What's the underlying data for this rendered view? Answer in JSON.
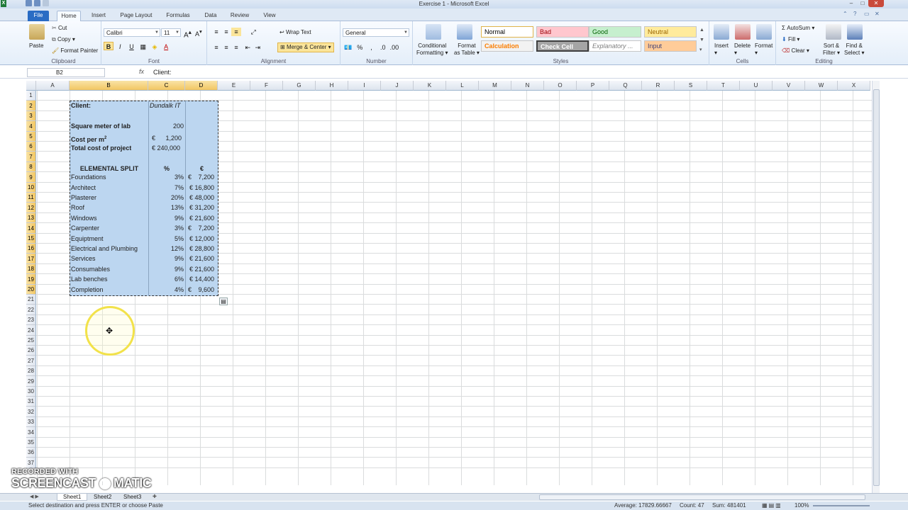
{
  "window": {
    "title": "Exercise 1 - Microsoft Excel"
  },
  "ribbon_tabs": [
    "File",
    "Home",
    "Insert",
    "Page Layout",
    "Formulas",
    "Data",
    "Review",
    "View"
  ],
  "clipboard": {
    "paste": "Paste",
    "cut": "Cut",
    "copy": "Copy",
    "format_painter": "Format Painter",
    "label": "Clipboard"
  },
  "font": {
    "family": "Calibri",
    "size": "11",
    "label": "Font",
    "bold": "B",
    "italic": "I",
    "underline": "U"
  },
  "alignment": {
    "wrap_text": "Wrap Text",
    "merge_center": "Merge & Center",
    "label": "Alignment"
  },
  "number": {
    "format": "General",
    "percent": "%",
    "comma": ",",
    "label": "Number"
  },
  "styles": {
    "conditional": "Conditional",
    "formatting": "Formatting",
    "format_as": "Format",
    "as_table": "as Table",
    "label": "Styles",
    "cells": [
      {
        "name": "Normal",
        "bg": "#ffffff",
        "fg": "#000000"
      },
      {
        "name": "Bad",
        "bg": "#ffc7ce",
        "fg": "#9c0006"
      },
      {
        "name": "Good",
        "bg": "#c6efce",
        "fg": "#006100"
      },
      {
        "name": "Neutral",
        "bg": "#ffeb9c",
        "fg": "#9c6500"
      },
      {
        "name": "Calculation",
        "bg": "#f2f2f2",
        "fg": "#fa7d00"
      },
      {
        "name": "Check Cell",
        "bg": "#a5a5a5",
        "fg": "#ffffff"
      },
      {
        "name": "Explanatory ...",
        "bg": "#ffffff",
        "fg": "#7f7f7f"
      },
      {
        "name": "Input",
        "bg": "#ffcc99",
        "fg": "#3f3f76"
      }
    ]
  },
  "cells_group": {
    "insert": "Insert",
    "delete": "Delete",
    "format": "Format",
    "label": "Cells"
  },
  "editing": {
    "autosum": "AutoSum",
    "fill": "Fill",
    "clear": "Clear",
    "sort": "Sort &",
    "filter": "Filter",
    "find": "Find &",
    "select": "Select",
    "label": "Editing"
  },
  "formula_bar": {
    "name_box": "B2",
    "fx": "fx",
    "content": "Client:"
  },
  "columns": [
    "A",
    "B",
    "C",
    "D",
    "E",
    "F",
    "G",
    "H",
    "I",
    "J",
    "K",
    "L",
    "M",
    "N",
    "O",
    "P",
    "Q",
    "R",
    "S",
    "T",
    "U",
    "V",
    "W",
    "X"
  ],
  "rows": [
    "1",
    "2",
    "3",
    "4",
    "5",
    "6",
    "7",
    "8",
    "9",
    "10",
    "11",
    "12",
    "13",
    "14",
    "15",
    "16",
    "17",
    "18",
    "19",
    "20",
    "21",
    "22",
    "23",
    "24",
    "25",
    "26",
    "27",
    "28",
    "29",
    "30",
    "31",
    "32",
    "33",
    "34",
    "35",
    "36",
    "37"
  ],
  "sheet": {
    "client_label": "Client:",
    "client_value": "Dundalk IT",
    "sqm_label": "Square meter of lab",
    "sqm_value": "200",
    "cost_label": "Cost per m",
    "cost_sup": "2",
    "cost_currency": "€",
    "cost_value": "1,200",
    "total_label": "Total cost of project",
    "total_value": "€ 240,000",
    "split_header": "ELEMENTAL SPLIT",
    "pct_header": "%",
    "eur_header": "€",
    "items": [
      {
        "name": "Foundations",
        "pct": "3%",
        "eur": "7,200"
      },
      {
        "name": "Architect",
        "pct": "7%",
        "eur": "€ 16,800"
      },
      {
        "name": "Plasterer",
        "pct": "20%",
        "eur": "€ 48,000"
      },
      {
        "name": "Roof",
        "pct": "13%",
        "eur": "€ 31,200"
      },
      {
        "name": "Windows",
        "pct": "9%",
        "eur": "€ 21,600"
      },
      {
        "name": "Carpenter",
        "pct": "3%",
        "eur": "7,200"
      },
      {
        "name": "Equiptment",
        "pct": "5%",
        "eur": "€ 12,000"
      },
      {
        "name": "Electrical and Plumbing",
        "pct": "12%",
        "eur": "€ 28,800"
      },
      {
        "name": "Services",
        "pct": "9%",
        "eur": "€ 21,600"
      },
      {
        "name": "Consumables",
        "pct": "9%",
        "eur": "€ 21,600"
      },
      {
        "name": "Lab benches",
        "pct": "6%",
        "eur": "€ 14,400"
      },
      {
        "name": "Completion",
        "pct": "4%",
        "eur": "9,600"
      }
    ]
  },
  "sheet_tabs": [
    "Sheet1",
    "Sheet2",
    "Sheet3"
  ],
  "status": {
    "message": "Select destination and press ENTER or choose Paste",
    "average": "Average: 17829.66667",
    "count": "Count: 47",
    "sum": "Sum: 481401",
    "zoom": "100%"
  },
  "watermark": {
    "line1": "RECORDED WITH",
    "line2": "SCREENCAST",
    "line3": "MATIC"
  }
}
